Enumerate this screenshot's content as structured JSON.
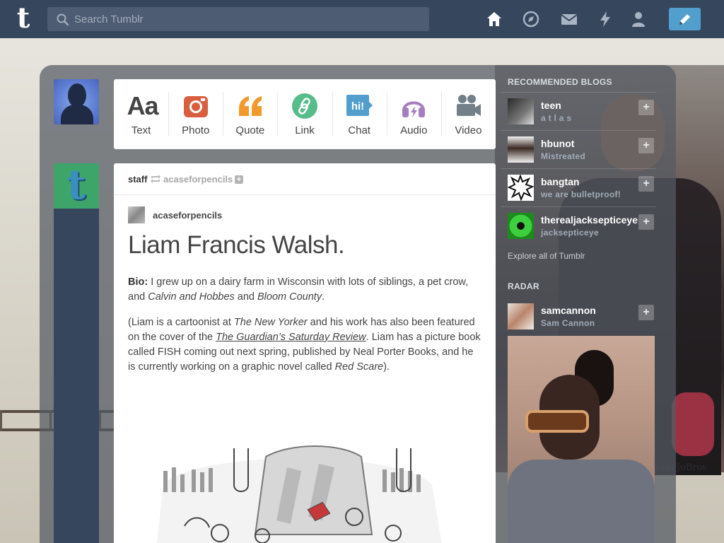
{
  "header": {
    "search_placeholder": "Search Tumblr"
  },
  "post_types": [
    {
      "label": "Text",
      "color": "#444444"
    },
    {
      "label": "Photo",
      "color": "#d95e40"
    },
    {
      "label": "Quote",
      "color": "#f2992e"
    },
    {
      "label": "Link",
      "color": "#56bc8a"
    },
    {
      "label": "Chat",
      "color": "#529ecc"
    },
    {
      "label": "Audio",
      "color": "#a77dc2"
    },
    {
      "label": "Video",
      "color": "#748089"
    }
  ],
  "post": {
    "author": "staff",
    "reblogged_from": "acaseforpencils",
    "source_blog": "acaseforpencils",
    "title": "Liam Francis Walsh.",
    "bio_label": "Bio:",
    "bio_text": " I grew up on a dairy farm in Wisconsin with lots of siblings, a pet crow, and ",
    "bio_work1": "Calvin and Hobbes",
    "bio_and": " and ",
    "bio_work2": "Bloom County",
    "bio_end": ".",
    "p2_a": "(Liam is a cartoonist at ",
    "p2_pub": "The New Yorker",
    "p2_b": " and his work has also been featured on the cover of the ",
    "p2_link": "The Guardian’s Saturday Review",
    "p2_c": ". Liam has a picture book called FISH coming out next spring, published by Neal Porter Books, and he is currently working on a graphic novel called ",
    "p2_novel": "Red Scare",
    "p2_d": ")."
  },
  "sidebar": {
    "recommended_title": "RECOMMENDED BLOGS",
    "blogs": [
      {
        "name": "teen",
        "subtitle": "a t l a s"
      },
      {
        "name": "hbunot",
        "subtitle": "Mistreated"
      },
      {
        "name": "bangtan",
        "subtitle": "we are bulletproof!"
      },
      {
        "name": "therealjacksepticeye",
        "subtitle": "jacksepticeye"
      }
    ],
    "explore": "Explore all of Tumblr",
    "radar_title": "RADAR",
    "radar_blog": {
      "name": "samcannon",
      "subtitle": "Sam Cannon"
    }
  },
  "background": {
    "watermark": "pForJoBros"
  }
}
